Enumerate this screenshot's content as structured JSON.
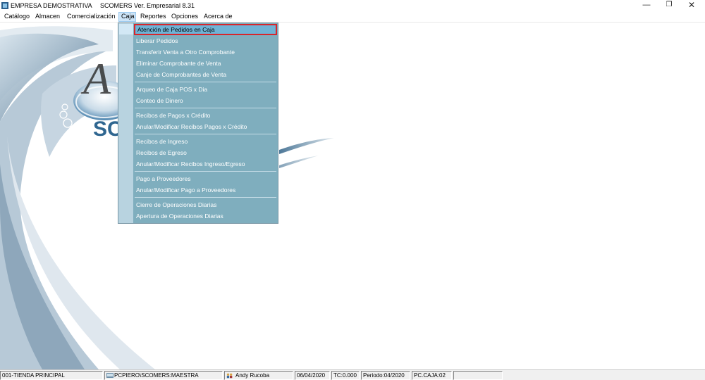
{
  "window": {
    "company": "EMPRESA DEMOSTRATIVA",
    "title": "SCOMERS Ver. Empresarial  8.31",
    "minimize_glyph": "—",
    "maximize_glyph": "❐",
    "close_glyph": "✕"
  },
  "menu": {
    "items": [
      {
        "label": "Catálogo"
      },
      {
        "label": "Almacen"
      },
      {
        "label": "Comercialización"
      },
      {
        "label": "Caja",
        "active": true
      },
      {
        "label": "Reportes"
      },
      {
        "label": "Opciones"
      },
      {
        "label": "Acerca de"
      }
    ]
  },
  "caja_menu": {
    "items": [
      {
        "label": "Atención de Pedidos en Caja",
        "selected": true
      },
      {
        "label": "Liberar Pedidos"
      },
      {
        "label": "Transferir Venta a Otro Comprobante"
      },
      {
        "label": "Eliminar Comprobante de Venta"
      },
      {
        "label": "Canje de Comprobantes de Venta"
      },
      {
        "label": "Arqueo de Caja POS x Dia"
      },
      {
        "label": "Conteo de Dinero"
      },
      {
        "label": "Recibos de Pagos x Crédito"
      },
      {
        "label": "Anular/Modificar Recibos Pagos x Crédito"
      },
      {
        "label": "Recibos de Ingreso"
      },
      {
        "label": "Recibos de Egreso"
      },
      {
        "label": "Anular/Modificar Recibos Ingreso/Egreso"
      },
      {
        "label": "Pago a Proveedores"
      },
      {
        "label": "Anular/Modificar Pago a Proveedores"
      },
      {
        "label": "Cierre de Operaciones Diarias"
      },
      {
        "label": "Apertura de Operaciones Diarias"
      }
    ]
  },
  "statusbar": {
    "store": "001-TIENDA PRINCIPAL",
    "database": "PCPIERO\\SCOMERS:MAESTRA",
    "user": "Andy Rucoba",
    "date": "06/04/2020",
    "tc": "TC:0.000",
    "period": "Periodo:04/2020",
    "pc": "PC.CAJA:02",
    "extra": ""
  },
  "logo_text": {
    "letter": "A",
    "word": "SCO"
  },
  "colors": {
    "menu_panel": "#7faebe",
    "selection_border": "#d8252b",
    "selection_fill": "#6fb3d6"
  }
}
